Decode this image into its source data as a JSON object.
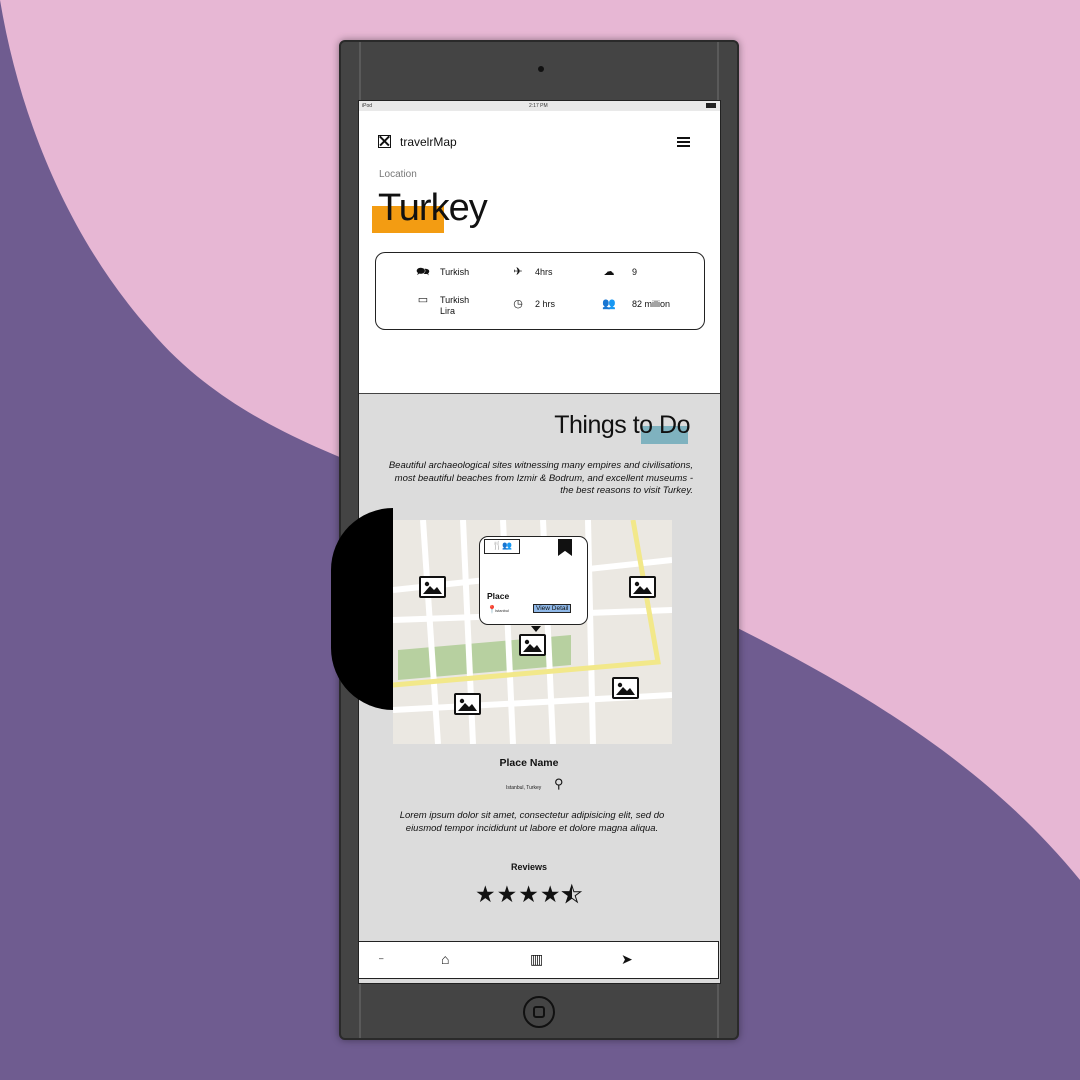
{
  "status_bar": {
    "left": "iPod",
    "time": "2:17 PM"
  },
  "header": {
    "app_name": "travelrMap",
    "logo_icon": "image-placeholder-icon",
    "menu_icon": "hamburger-icon"
  },
  "location": {
    "label": "Location",
    "country": "Turkey"
  },
  "info": [
    {
      "icon": "language-icon",
      "value": "Turkish"
    },
    {
      "icon": "plane-icon",
      "value": "4hrs"
    },
    {
      "icon": "weather-icon",
      "value": "9"
    },
    {
      "icon": "currency-icon",
      "value": "Turkish Lira"
    },
    {
      "icon": "clock-icon",
      "value": "2 hrs"
    },
    {
      "icon": "people-icon",
      "value": "82 million"
    }
  ],
  "things": {
    "title": "Things to Do",
    "description": "Beautiful archaeological sites witnessing many empires and civilisations, most beautiful beaches from Izmir & Bodrum, and excellent museums - the best reasons to visit Turkey."
  },
  "map_popup": {
    "place": "Place",
    "location": "Istanbul",
    "button": "View Detail"
  },
  "place": {
    "name": "Place Name",
    "location": "Istanbul, Turkey",
    "description": "Lorem ipsum dolor sit amet, consectetur adipisicing elit, sed do eiusmod tempor incididunt ut labore et dolore magna aliqua.",
    "reviews_label": "Reviews",
    "rating": 4.5,
    "max_rating": 5
  },
  "nav": [
    "home-icon",
    "map-icon",
    "location-arrow-icon"
  ],
  "colors": {
    "accent_orange": "#f39c12",
    "accent_teal": "#7fb2bf",
    "bg_pink": "#e7b7d4",
    "bg_purple": "#6f5c90"
  }
}
